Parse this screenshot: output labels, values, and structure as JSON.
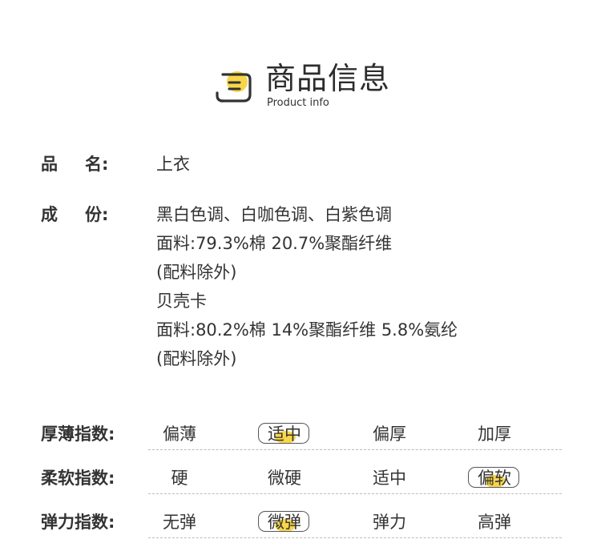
{
  "header": {
    "title": "商品信息",
    "subtitle": "Product info",
    "accent_color": "#f8d64a",
    "icon": "document-icon"
  },
  "info": [
    {
      "label_a": "品",
      "label_b": "名:",
      "lines": [
        "上衣"
      ]
    },
    {
      "label_a": "成",
      "label_b": "份:",
      "lines": [
        "黑白色调、白咖色调、白紫色调",
        "面料:79.3%棉 20.7%聚酯纤维",
        "(配料除外)",
        "贝壳卡",
        "面料:80.2%棉 14%聚酯纤维 5.8%氨纶",
        "(配料除外)"
      ]
    }
  ],
  "indices": [
    {
      "label": "厚薄指数:",
      "options": [
        "偏薄",
        "适中",
        "偏厚",
        "加厚"
      ],
      "selected": 1
    },
    {
      "label": "柔软指数:",
      "options": [
        "硬",
        "微硬",
        "适中",
        "偏软"
      ],
      "selected": 3
    },
    {
      "label": "弹力指数:",
      "options": [
        "无弹",
        "微弹",
        "弹力",
        "高弹"
      ],
      "selected": 1
    }
  ]
}
